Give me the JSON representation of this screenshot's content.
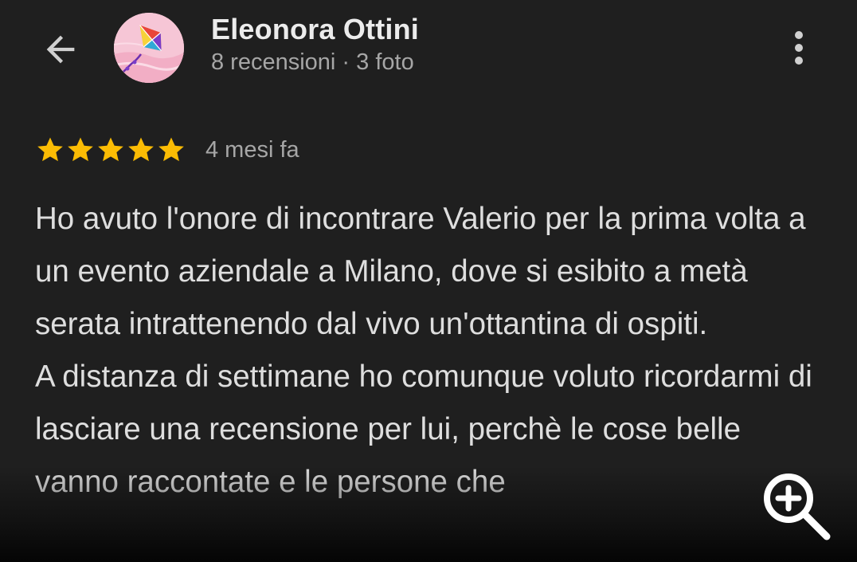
{
  "header": {
    "back_icon": "arrow-back-icon",
    "avatar_icon": "kite-avatar",
    "reviewer_name": "Eleonora Ottini",
    "reviewer_meta": "8 recensioni · 3 foto",
    "more_icon": "more-vert-icon"
  },
  "review": {
    "rating": 5,
    "rating_max": 5,
    "star_color": "#FBBC04",
    "date": "4 mesi fa",
    "paragraphs": [
      "Ho avuto l'onore di incontrare Valerio per la prima volta a un evento aziendale a Milano, dove si esibito a metà serata intrattenendo dal vivo un'ottantina di ospiti.",
      "A distanza di settimane ho comunque voluto ricordarmi di lasciare una recensione per lui, perchè le cose belle vanno raccontate e le persone che"
    ]
  },
  "overlay": {
    "zoom_icon": "zoom-in-icon"
  }
}
